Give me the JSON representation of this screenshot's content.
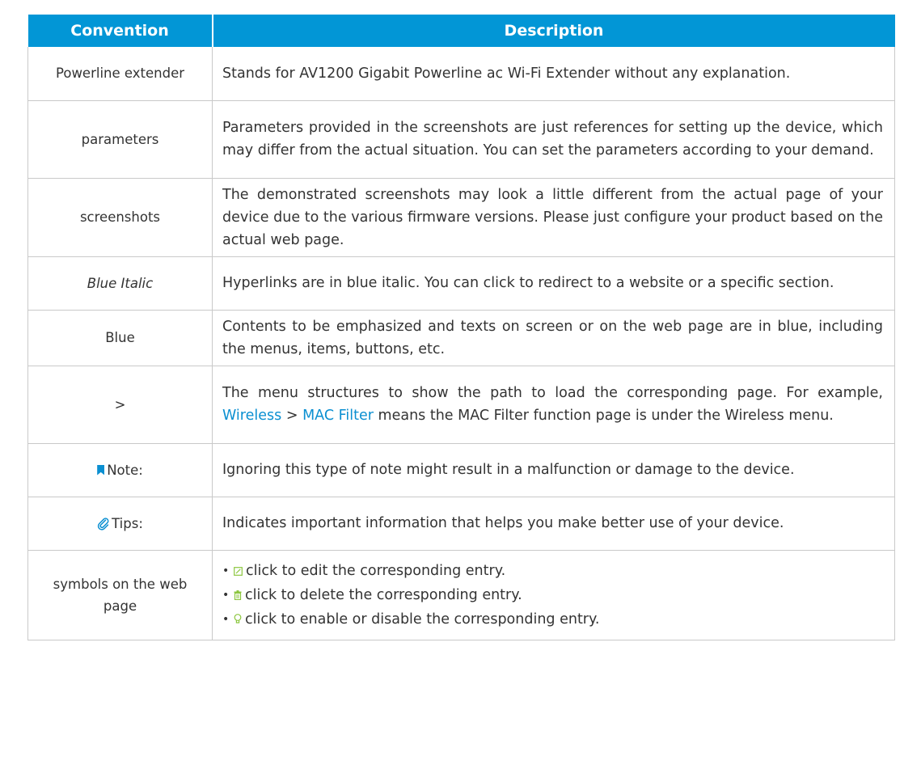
{
  "table": {
    "headers": {
      "convention": "Convention",
      "description": "Description"
    },
    "rows": {
      "powerline": {
        "convention": "Powerline extender",
        "description": "Stands for AV1200 Gigabit Powerline ac Wi-Fi Extender without any explanation."
      },
      "parameters": {
        "convention": "parameters",
        "description": "Parameters provided in the screenshots are just references for setting up the device, which may differ from the actual situation. You can set the parameters according to your demand."
      },
      "screenshots": {
        "convention": "screenshots",
        "description": "The demonstrated screenshots may look a little different from the actual page of your device due to the various firmware versions. Please just configure your product based on the actual web page."
      },
      "blue_italic": {
        "convention": "Blue Italic",
        "description": "Hyperlinks are in blue italic. You can click to redirect to a website or a specific section."
      },
      "blue": {
        "convention": "Blue",
        "description": "Contents to be emphasized and texts on screen or on the web page are in blue, including the menus, items, buttons, etc."
      },
      "gt": {
        "convention": ">",
        "description": {
          "intro": "The menu structures to show the path to load the corresponding page. For example,",
          "wireless": "Wireless",
          "sep": ">",
          "mac_filter": "MAC Filter",
          "outro": "means the MAC Filter function page is under the Wireless menu."
        }
      },
      "note": {
        "icon": "bookmark-icon",
        "convention": "Note:",
        "description": "Ignoring this type of note might result in a malfunction or damage to the device."
      },
      "tips": {
        "icon": "paperclip-icon",
        "convention": "Tips:",
        "description": "Indicates important information that helps you make better use of your device."
      },
      "symbols": {
        "convention": "symbols on the web page",
        "items": {
          "edit": {
            "icon": "edit-icon",
            "text": "click to edit the corresponding entry."
          },
          "delete": {
            "icon": "trash-icon",
            "text": "click to delete the corresponding entry."
          },
          "enable": {
            "icon": "bulb-icon",
            "text": "click to enable or disable the corresponding entry."
          }
        }
      }
    }
  },
  "colors": {
    "header_bg": "#0296d6",
    "link_blue": "#0a8fd1",
    "icon_green": "#8cc63f",
    "border": "#c9c9c9"
  }
}
